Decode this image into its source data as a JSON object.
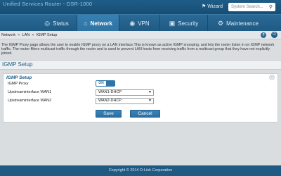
{
  "header": {
    "product_name": "Unified Services Router - DSR-1000",
    "wizard_label": "Wizard",
    "search_placeholder": "System Search..."
  },
  "nav": {
    "tabs": [
      {
        "label": "Status",
        "icon": "status-icon"
      },
      {
        "label": "Network",
        "icon": "network-icon",
        "active": true
      },
      {
        "label": "VPN",
        "icon": "vpn-icon"
      },
      {
        "label": "Security",
        "icon": "security-icon"
      },
      {
        "label": "Maintenance",
        "icon": "maintenance-icon"
      }
    ]
  },
  "breadcrumb": {
    "items": [
      "Network",
      "LAN",
      "IGMP Setup"
    ],
    "separator": "»"
  },
  "description": "The IGMP Proxy page allows the user to enable IGMP proxy on a LAN interface.This is known as active IGMP snooping, and lets the router listen in on IGMP network traffic. The router filters multicast traffic through the router and is used to prevent LAN hosts from receiving traffic from a multicast group that they have not explicitly joined.",
  "section": {
    "title": "IGMP Setup"
  },
  "panel": {
    "title": "IGMP Setup",
    "close_glyph": "−",
    "fields": {
      "proxy_label": "IGMP Proxy",
      "proxy_toggle": "ON",
      "wan1_label": "Upstreaminterface WAN1",
      "wan1_value": "WAN1-DHCP",
      "wan2_label": "Upstreaminterface WAN2",
      "wan2_value": "WAN2-DHCP"
    },
    "save_label": "Save",
    "cancel_label": "Cancel"
  },
  "footer": {
    "copyright": "Copyright © 2014 D-Link Corporation"
  },
  "colors": {
    "brand_blue": "#1e5d88",
    "nav_blue": "#2a6a96",
    "button_blue": "#2f74a8"
  }
}
